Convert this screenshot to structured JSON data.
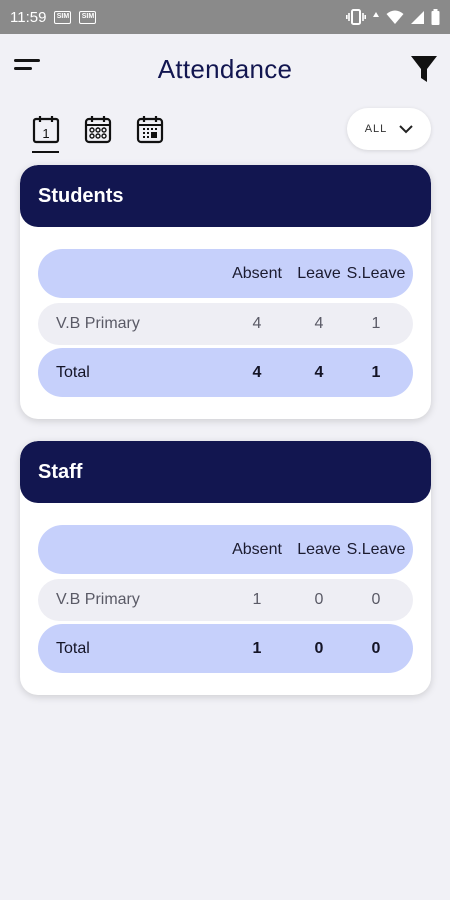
{
  "status_bar": {
    "time": "11:59",
    "sim1": "SIM",
    "sim2": "SIM"
  },
  "header": {
    "title": "Attendance"
  },
  "toolbar": {
    "periods": [
      "day-calendar-icon",
      "week-calendar-icon",
      "month-calendar-icon"
    ],
    "day_number": "1",
    "scope": {
      "selected": "ALL"
    }
  },
  "colors": {
    "brand": "#121650",
    "row_highlight": "#c6d0fb",
    "row_plain": "#eeeef4"
  },
  "students": {
    "title": "Students",
    "columns": [
      "Absent",
      "Leave",
      "S.Leave"
    ],
    "rows": [
      {
        "name": "V.B Primary",
        "absent": "4",
        "leave": "4",
        "sleave": "1"
      }
    ],
    "total": {
      "name": "Total",
      "absent": "4",
      "leave": "4",
      "sleave": "1"
    }
  },
  "staff": {
    "title": "Staff",
    "columns": [
      "Absent",
      "Leave",
      "S.Leave"
    ],
    "rows": [
      {
        "name": "V.B Primary",
        "absent": "1",
        "leave": "0",
        "sleave": "0"
      }
    ],
    "total": {
      "name": "Total",
      "absent": "1",
      "leave": "0",
      "sleave": "0"
    }
  }
}
